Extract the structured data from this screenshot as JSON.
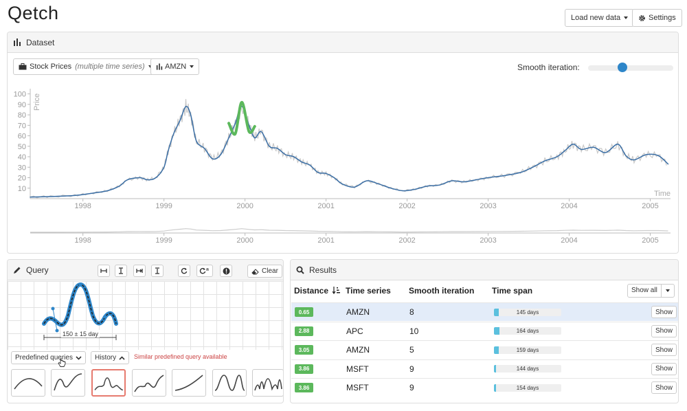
{
  "app": {
    "title": "Qetch"
  },
  "header": {
    "load_label": "Load new data",
    "settings_label": "Settings"
  },
  "dataset": {
    "title": "Dataset",
    "source_label": "Stock Prices",
    "source_sub": "(multiple time series)",
    "series_label": "AMZN",
    "smooth_label": "Smooth iteration:",
    "smooth_level": 0.4
  },
  "chart_data": {
    "type": "line",
    "ylabel": "Price",
    "xlabel": "Time",
    "y_ticks": [
      10,
      20,
      30,
      40,
      50,
      60,
      70,
      80,
      90,
      100
    ],
    "x_ticks": [
      "1998",
      "1999",
      "2000",
      "2001",
      "2002",
      "2003",
      "2004",
      "2005"
    ],
    "ylim": [
      0,
      105
    ],
    "xlim": [
      1997.35,
      2005.25
    ],
    "series": [
      {
        "role": "smoothed",
        "color": "#3a6ea5",
        "x": [
          1997.35,
          1997.6,
          1997.9,
          1998.1,
          1998.3,
          1998.45,
          1998.55,
          1998.7,
          1998.8,
          1998.9,
          1999.0,
          1999.05,
          1999.12,
          1999.2,
          1999.27,
          1999.33,
          1999.4,
          1999.5,
          1999.6,
          1999.7,
          1999.8,
          1999.88,
          1999.96,
          2000.05,
          2000.12,
          2000.2,
          2000.3,
          2000.4,
          2000.5,
          2000.6,
          2000.7,
          2000.8,
          2000.9,
          2001.0,
          2001.1,
          2001.2,
          2001.35,
          2001.5,
          2001.65,
          2001.8,
          2001.95,
          2002.1,
          2002.25,
          2002.4,
          2002.55,
          2002.7,
          2002.85,
          2003.0,
          2003.2,
          2003.4,
          2003.55,
          2003.7,
          2003.85,
          2003.95,
          2004.05,
          2004.15,
          2004.3,
          2004.45,
          2004.6,
          2004.7,
          2004.8,
          2004.95,
          2005.1,
          2005.22
        ],
        "y": [
          1.5,
          2,
          3,
          5,
          7.5,
          12,
          18,
          20,
          18,
          20,
          30,
          45,
          62,
          75,
          88,
          80,
          55,
          48,
          38,
          42,
          58,
          72,
          88,
          70,
          58,
          64,
          50,
          48,
          42,
          40,
          35,
          32,
          25,
          24,
          20,
          14,
          11,
          17,
          14,
          10,
          7.5,
          9,
          12,
          13,
          17,
          16,
          18,
          20,
          22,
          25,
          30,
          36,
          40,
          46,
          52,
          47,
          49,
          44,
          52,
          41,
          37,
          42,
          41,
          33
        ]
      },
      {
        "role": "match",
        "color": "#5cb85c",
        "x": [
          1999.8,
          1999.88,
          1999.96,
          2000.05,
          2000.12
        ],
        "y": [
          72,
          62,
          92,
          64,
          69
        ]
      }
    ]
  },
  "query": {
    "title": "Query",
    "clear_label": "Clear",
    "span_label": "150 ± 15 day",
    "predefined_label": "Predefined queries",
    "history_label": "History",
    "similar_note": "Similar predefined query available"
  },
  "results": {
    "title": "Results",
    "col_distance": "Distance",
    "col_series": "Time series",
    "col_smooth": "Smooth iteration",
    "col_span": "Time span",
    "show_all_label": "Show all",
    "show_label": "Show",
    "rows": [
      {
        "distance": "0.65",
        "series": "AMZN",
        "smooth": "8",
        "span": "145 days",
        "fill": 0.07,
        "highlight": true
      },
      {
        "distance": "2.88",
        "series": "APC",
        "smooth": "10",
        "span": "164 days",
        "fill": 0.08,
        "highlight": false
      },
      {
        "distance": "3.05",
        "series": "AMZN",
        "smooth": "5",
        "span": "159 days",
        "fill": 0.075,
        "highlight": false
      },
      {
        "distance": "3.86",
        "series": "MSFT",
        "smooth": "9",
        "span": "144 days",
        "fill": 0.03,
        "highlight": false
      },
      {
        "distance": "3.86",
        "series": "MSFT",
        "smooth": "9",
        "span": "154 days",
        "fill": 0.03,
        "highlight": false
      }
    ]
  },
  "colors": {
    "accent": "#2e86c9",
    "badge": "#5cb85c",
    "match": "#5cb85c",
    "series": "#3a6ea5",
    "highlight": "#e3ecf9",
    "note": "#cc4444"
  }
}
